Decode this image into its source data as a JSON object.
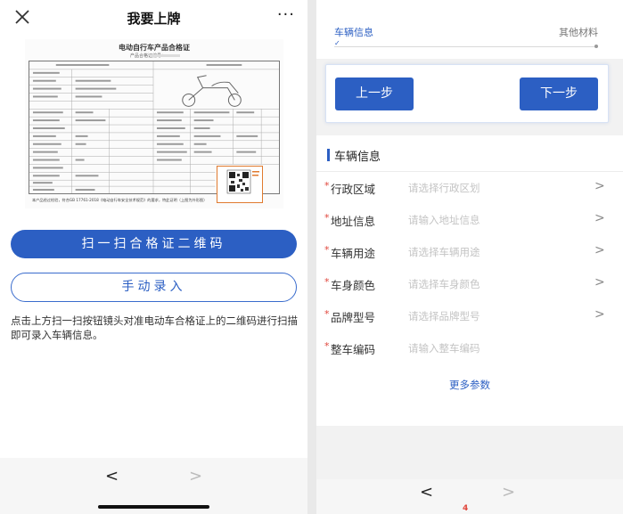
{
  "left": {
    "title": "我要上牌",
    "more_label": "···",
    "certificate": {
      "title": "电动自行车产品合格证",
      "no_label": "产品合格证编号：",
      "footer": "本产品经过检验，符合GB 17761-2018《电动自行车安全技术规范》的要求，特此证明（上图为外形图）"
    },
    "scan_button": "扫一扫合格证二维码",
    "manual_button": "手动录入",
    "hint": "点击上方扫一扫按钮镜头对准电动车合格证上的二维码进行扫描即可录入车辆信息。",
    "nav": {
      "back": "<",
      "forward": ">"
    }
  },
  "right": {
    "steps": [
      {
        "label": "车辆信息",
        "state": "active"
      },
      {
        "label": "其他材料",
        "state": "pending"
      }
    ],
    "step_check": "✓",
    "prev_button": "上一步",
    "next_button": "下一步",
    "section_title": "车辆信息",
    "fields": [
      {
        "label": "行政区域",
        "placeholder": "请选择行政区划",
        "required": true,
        "chevron": ">"
      },
      {
        "label": "地址信息",
        "placeholder": "请输入地址信息",
        "required": true,
        "chevron": ">"
      },
      {
        "label": "车辆用途",
        "placeholder": "请选择车辆用途",
        "required": true,
        "chevron": ">"
      },
      {
        "label": "车身颜色",
        "placeholder": "请选择车身颜色",
        "required": true,
        "chevron": ">"
      },
      {
        "label": "品牌型号",
        "placeholder": "请选择品牌型号",
        "required": true,
        "chevron": ">"
      },
      {
        "label": "整车编码",
        "placeholder": "请输入整车编码",
        "required": true,
        "chevron": ""
      }
    ],
    "required_mark": "*",
    "more_params": "更多参数",
    "nav": {
      "back": "<",
      "forward": ">"
    },
    "corner_mark": "4"
  },
  "colors": {
    "accent": "#2c5fc3",
    "required": "#e0463c",
    "placeholder": "#c4c4c4"
  }
}
